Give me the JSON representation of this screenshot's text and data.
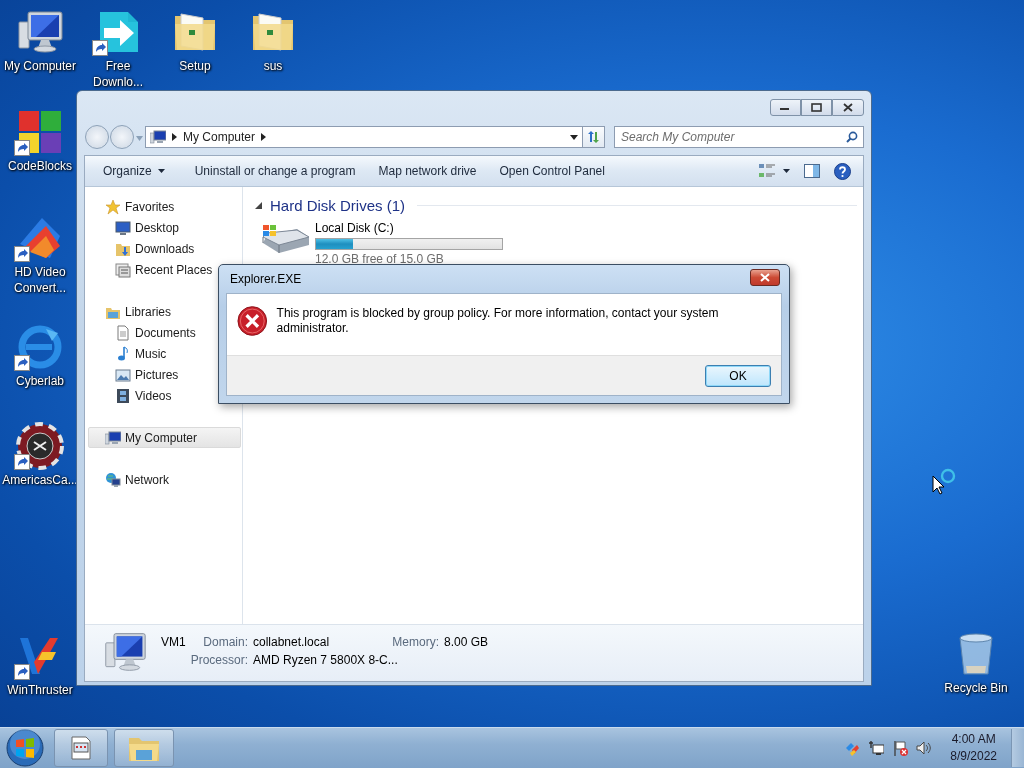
{
  "desktop_icons": [
    {
      "label": "My Computer",
      "kind": "computer",
      "shortcut": false
    },
    {
      "label": "Free Downlo...",
      "kind": "arrow",
      "shortcut": true
    },
    {
      "label": "Setup",
      "kind": "folder",
      "shortcut": false
    },
    {
      "label": "sus",
      "kind": "folder",
      "shortcut": false
    },
    {
      "label": "CodeBlocks",
      "kind": "squares",
      "shortcut": true
    },
    {
      "label": "HD Video Convert...",
      "kind": "triangle",
      "shortcut": true
    },
    {
      "label": "Cyberlab",
      "kind": "swirl",
      "shortcut": true
    },
    {
      "label": "AmericasCa...",
      "kind": "chip",
      "shortcut": true
    },
    {
      "label": "WinThruster",
      "kind": "vlogo",
      "shortcut": true
    },
    {
      "label": "Recycle Bin",
      "kind": "bin",
      "shortcut": false
    }
  ],
  "explorer": {
    "address": {
      "crumbs": [
        "My Computer"
      ]
    },
    "search": {
      "placeholder": "Search My Computer"
    },
    "toolbar": [
      {
        "label": "Organize",
        "dropdown": true
      },
      {
        "label": "Uninstall or change a program",
        "dropdown": false
      },
      {
        "label": "Map network drive",
        "dropdown": false
      },
      {
        "label": "Open Control Panel",
        "dropdown": false
      }
    ],
    "sidebar": [
      {
        "label": "Favorites",
        "kind": "star",
        "selected": false,
        "children": [
          {
            "label": "Desktop",
            "kind": "desktop",
            "selected": false
          },
          {
            "label": "Downloads",
            "kind": "downloads",
            "selected": false
          },
          {
            "label": "Recent Places",
            "kind": "recent",
            "selected": false
          }
        ]
      },
      {
        "label": "Libraries",
        "kind": "library",
        "selected": false,
        "children": [
          {
            "label": "Documents",
            "kind": "documents",
            "selected": false
          },
          {
            "label": "Music",
            "kind": "music",
            "selected": false
          },
          {
            "label": "Pictures",
            "kind": "pictures",
            "selected": false
          },
          {
            "label": "Videos",
            "kind": "videos",
            "selected": false
          }
        ]
      },
      {
        "label": "My Computer",
        "kind": "computer",
        "selected": true
      },
      {
        "label": "Network",
        "kind": "network",
        "selected": false
      }
    ],
    "sections": [
      {
        "title": "Hard Disk Drives (1)",
        "expanded": true,
        "drives": [
          {
            "name": "Local Disk (C:)",
            "level": 0.2,
            "free_text": "12.0 GB free of 15.0 GB"
          }
        ]
      }
    ],
    "details": {
      "name": "VM1",
      "fields": [
        {
          "label": "Domain:",
          "value": "collabnet.local"
        },
        {
          "label": "Memory:",
          "value": "8.00 GB"
        },
        {
          "label": "Processor:",
          "value": "AMD Ryzen 7 5800X 8-C..."
        }
      ]
    }
  },
  "dialog": {
    "title": "Explorer.EXE",
    "kind": "error",
    "message": "This program is blocked by group policy. For more information, contact your system administrator.",
    "buttons": [
      {
        "label": "OK",
        "default": true
      }
    ]
  },
  "taskbar": {
    "tasks": [
      {
        "kind": "app"
      },
      {
        "kind": "explorer"
      }
    ],
    "tray": [
      {
        "kind": "colors"
      },
      {
        "kind": "network"
      },
      {
        "kind": "flag"
      },
      {
        "kind": "speaker"
      }
    ],
    "time": "4:00 AM",
    "date": "8/9/2022"
  }
}
